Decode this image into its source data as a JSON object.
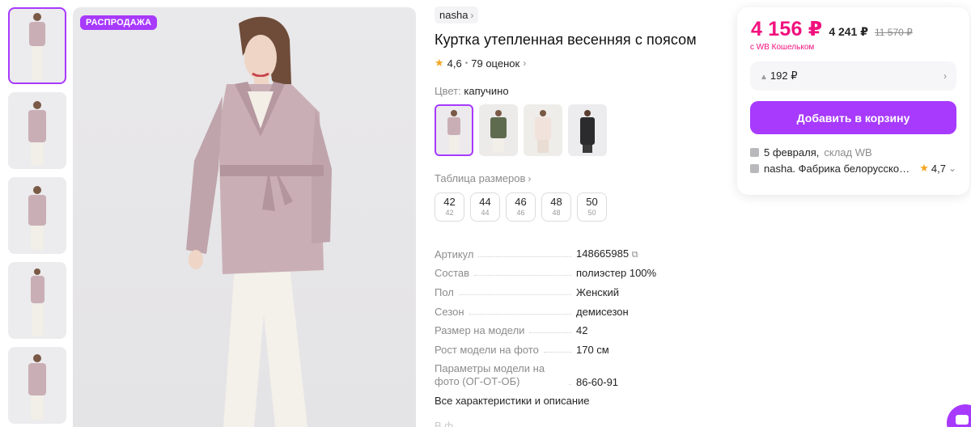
{
  "gallery": {
    "sale_badge": "РАСПРОДАЖА",
    "thumb_count": 5
  },
  "product": {
    "brand": "nasha",
    "title": "Куртка утепленная весенняя с поясом",
    "rating": "4,6",
    "reviews": "79 оценок",
    "color_label": "Цвет:",
    "color_value": "капучино",
    "size_table_link": "Таблица размеров",
    "sizes": [
      {
        "num": "42",
        "sub": "42"
      },
      {
        "num": "44",
        "sub": "44"
      },
      {
        "num": "46",
        "sub": "46"
      },
      {
        "num": "48",
        "sub": "48"
      },
      {
        "num": "50",
        "sub": "50"
      }
    ],
    "specs": [
      {
        "key": "Артикул",
        "value": "148665985"
      },
      {
        "key": "Состав",
        "value": "полиэстер 100%"
      },
      {
        "key": "Пол",
        "value": "Женский"
      },
      {
        "key": "Сезон",
        "value": "демисезон"
      },
      {
        "key": "Размер на модели",
        "value": "42"
      },
      {
        "key": "Рост модели на фото",
        "value": "170 см"
      },
      {
        "key": "Параметры модели на фото (ОГ-ОТ-ОБ)",
        "value": "86-60-91"
      }
    ],
    "all_specs_link": "Все характеристики и описание",
    "faded_text": "В                ф  ..."
  },
  "buy_card": {
    "price": "4 156 ₽",
    "price_alt": "4 241 ₽",
    "old_price": "11 570 ₽",
    "wallet_note": "с WB Кошельком",
    "bonus": "192 ₽",
    "add_to_cart": "Добавить в корзину",
    "delivery_date": "5 февраля,",
    "warehouse": "склад WB",
    "seller": "nasha. Фабрика белорусской о...",
    "seller_rating": "4,7"
  },
  "colors": {
    "accent": "#a73afd",
    "price": "#f1117e",
    "jacket": "#c9afb5"
  }
}
